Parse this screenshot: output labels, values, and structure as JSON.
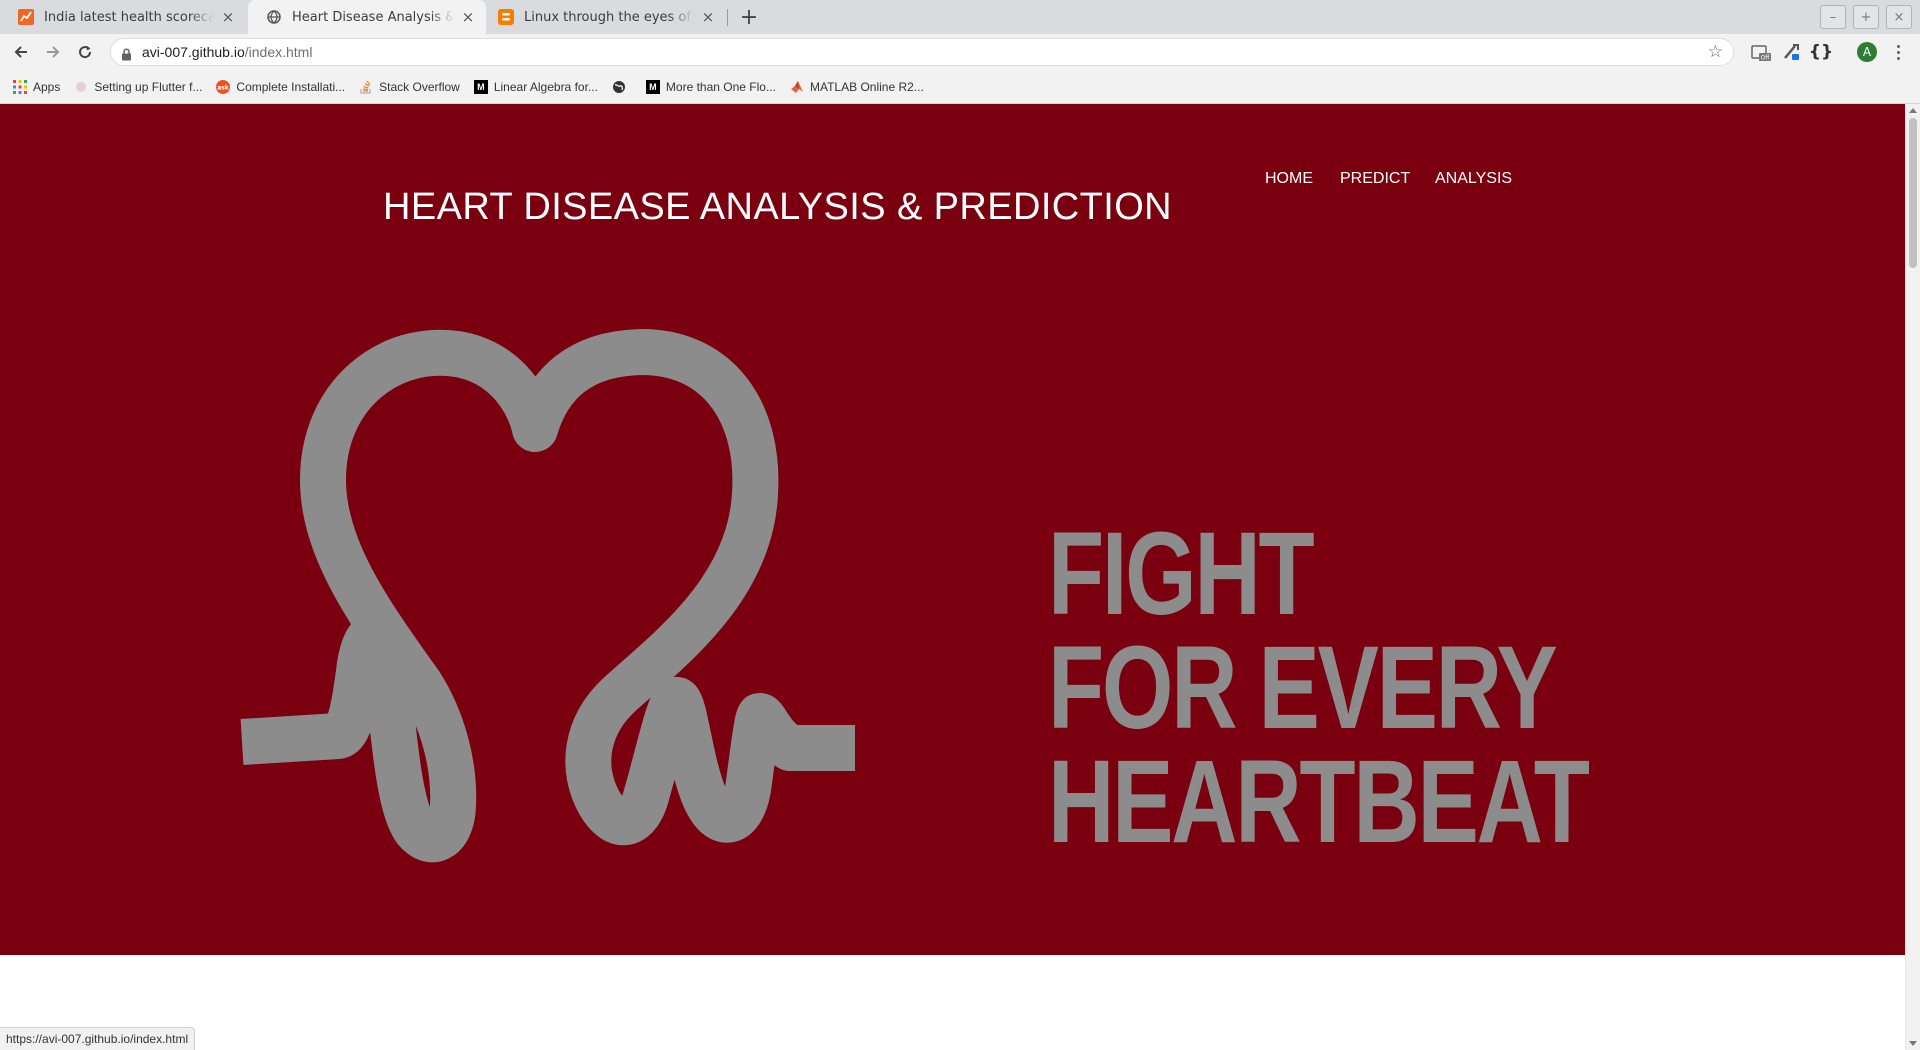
{
  "tabs": [
    {
      "title": "India latest health scorecard: M",
      "active": false,
      "favicon": "chart-favicon-icon"
    },
    {
      "title": "Heart Disease Analysis & Predic",
      "active": true,
      "favicon": "globe-favicon-icon"
    },
    {
      "title": "Linux through the eyes of a noo",
      "active": false,
      "favicon": "blogger-favicon-icon"
    }
  ],
  "window_controls": {
    "minimize": "–",
    "maximize": "+",
    "close": "×"
  },
  "address_bar": {
    "domain": "avi-007.github.io",
    "path": "/index.html"
  },
  "profile": {
    "initial": "A"
  },
  "bookmarks": [
    {
      "label": "Apps",
      "icon": "apps-grid-icon"
    },
    {
      "label": "Setting up Flutter f...",
      "icon": "flutter-icon"
    },
    {
      "label": "Complete Installati...",
      "icon": "askubuntu-icon"
    },
    {
      "label": "Stack Overflow",
      "icon": "stackoverflow-icon"
    },
    {
      "label": "Linear Algebra for...",
      "icon": "medium-icon"
    },
    {
      "label": "",
      "icon": "globe-icon"
    },
    {
      "label": "More than One Flo...",
      "icon": "medium-icon"
    },
    {
      "label": "MATLAB Online R2...",
      "icon": "matlab-icon"
    }
  ],
  "site": {
    "title": "HEART DISEASE ANALYSIS & PREDICTION",
    "nav": [
      "HOME",
      "PREDICT",
      "ANALYSIS"
    ],
    "slogan": [
      "FIGHT",
      "FOR EVERY",
      "HEARTBEAT"
    ]
  },
  "colors": {
    "hero_background": "#7a0010",
    "logo_gray": "#8c8c8c"
  },
  "status_bar": {
    "url": "https://avi-007.github.io/index.html"
  }
}
